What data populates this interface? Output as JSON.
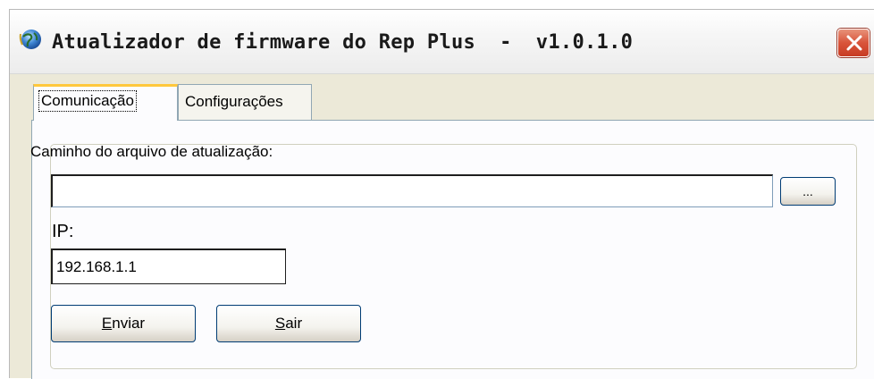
{
  "window": {
    "title": "Atualizador de firmware do Rep Plus  -  v1.0.1.0"
  },
  "icons": {
    "app": "globe-icon",
    "close": "close-icon"
  },
  "colors": {
    "close_button": "#d9543a",
    "active_tab_highlight": "#ffc83c",
    "window_face": "#ece9d8"
  },
  "tabs": [
    {
      "label": "Comunicação",
      "active": true
    },
    {
      "label": "Configurações",
      "active": false
    }
  ],
  "form": {
    "path_label": "Caminho do arquivo de atualização:",
    "path_value": "",
    "browse_label": "...",
    "ip_label": "IP:",
    "ip_value": "192.168.1.1"
  },
  "buttons": {
    "send_label": "Enviar",
    "exit_label": "Sair"
  }
}
